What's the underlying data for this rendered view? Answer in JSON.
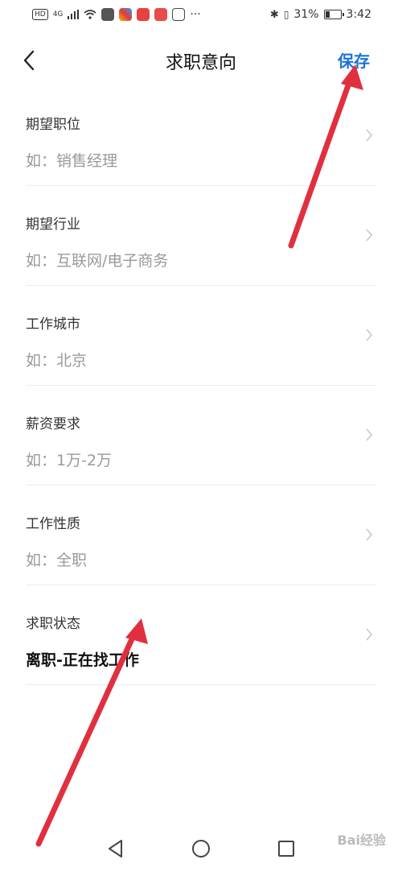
{
  "status_bar": {
    "hd": "HD",
    "signal": "4G",
    "battery_pct": "31%",
    "battery_level": 0.31,
    "time": "3:42",
    "more": "···"
  },
  "header": {
    "title": "求职意向",
    "save_label": "保存"
  },
  "form": {
    "rows": [
      {
        "label": "期望职位",
        "value": "如：销售经理"
      },
      {
        "label": "期望行业",
        "value": "如：互联网/电子商务"
      },
      {
        "label": "工作城市",
        "value": "如：北京"
      },
      {
        "label": "薪资要求",
        "value": "如：1万-2万"
      },
      {
        "label": "工作性质",
        "value": "如：全职"
      },
      {
        "label": "求职状态",
        "value": "离职-正在找工作"
      }
    ]
  },
  "watermark": "Bai经验",
  "colors": {
    "accent": "#1a73d9",
    "annotation_arrow": "#e0303f"
  }
}
